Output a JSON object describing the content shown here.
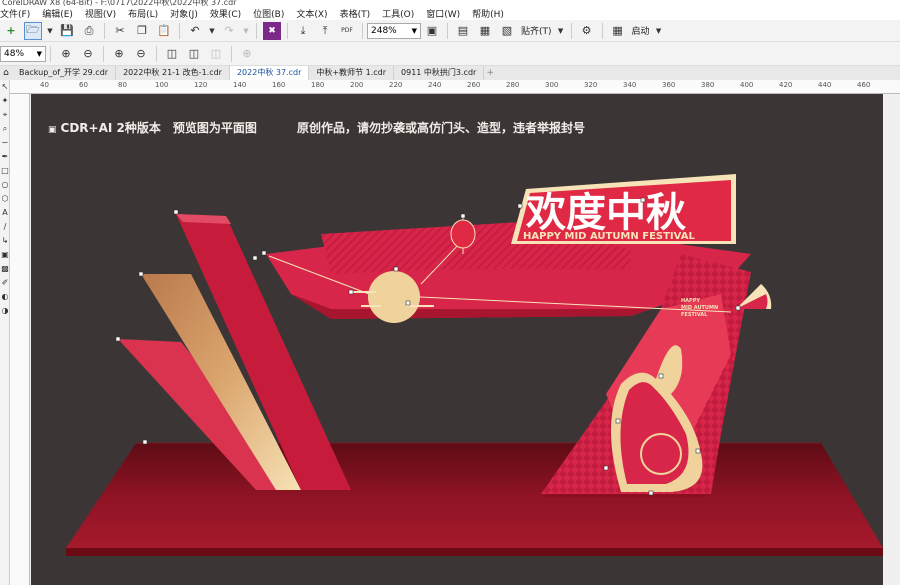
{
  "window": {
    "title": "CorelDRAW X8 (64-Bit) - F:\\0717\\2022中秋\\2022中秋 37.cdr"
  },
  "menu": [
    "文件(F)",
    "编辑(E)",
    "视图(V)",
    "布局(L)",
    "对象(J)",
    "效果(C)",
    "位图(B)",
    "文本(X)",
    "表格(T)",
    "工具(O)",
    "窗口(W)",
    "帮助(H)"
  ],
  "toolbar": {
    "zoom_value": "248%",
    "snap_label": "贴齐(T)",
    "launch_label": "启动",
    "property_zoom": "48%",
    "pdf_label": "PDF"
  },
  "tabs": [
    {
      "label": "Backup_of_开学 29.cdr",
      "active": false
    },
    {
      "label": "2022中秋 21-1 改色-1.cdr",
      "active": false
    },
    {
      "label": "2022中秋 37.cdr",
      "active": true
    },
    {
      "label": "中秋+教师节 1.cdr",
      "active": false
    },
    {
      "label": "0911 中秋拱门3.cdr",
      "active": false
    }
  ],
  "ruler_labels": [
    "40",
    "60",
    "80",
    "100",
    "120",
    "140",
    "160",
    "180",
    "200",
    "220",
    "240",
    "260",
    "280",
    "300",
    "320",
    "340",
    "360",
    "380",
    "400",
    "420",
    "440",
    "460"
  ],
  "canvas": {
    "caption_left": "CDR+AI 2种版本　预览图为平面图",
    "caption_right": "原创作品，请勿抄袭或高仿门头、造型，违者举报封号",
    "sign_title": "欢度中秋",
    "sign_subtitle": "HAPPY MID AUTUMN FESTIVAL",
    "small_sign_line1": "HAPPY",
    "small_sign_line2": "MID AUTUMN",
    "small_sign_line3": "FESTIVAL"
  },
  "colors": {
    "canvas_bg": "#3b3635",
    "red": "#d7264a",
    "dark_red": "#8e1020",
    "gold": "#e8c48e",
    "cream": "#f7e3b8"
  }
}
